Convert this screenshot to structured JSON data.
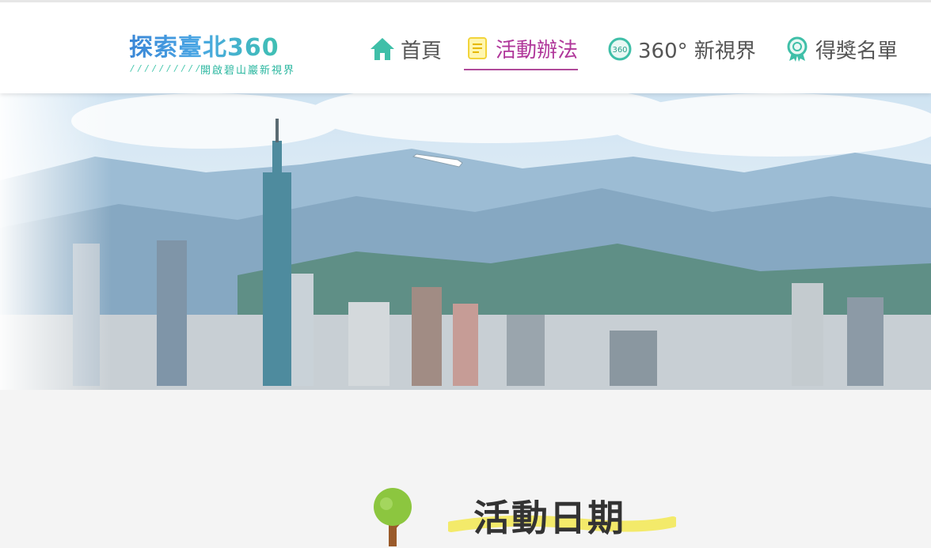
{
  "logo": {
    "title": "探索臺北360",
    "subtitle": "開啟碧山巖新視界",
    "deco": "/ / / / / / / / / /"
  },
  "nav": {
    "items": [
      {
        "label": "首頁",
        "icon": "home-icon",
        "active": false
      },
      {
        "label": "活動辦法",
        "icon": "document-icon",
        "active": true
      },
      {
        "label": "360° 新視界",
        "icon": "360-icon",
        "active": false
      },
      {
        "label": "得獎名單",
        "icon": "award-ribbon-icon",
        "active": false
      }
    ]
  },
  "colors": {
    "accent": "#b0379a",
    "teal": "#3fbfa8",
    "highlight": "#f3ea6a"
  },
  "section": {
    "title": "活動日期",
    "icon": "tree-icon"
  }
}
